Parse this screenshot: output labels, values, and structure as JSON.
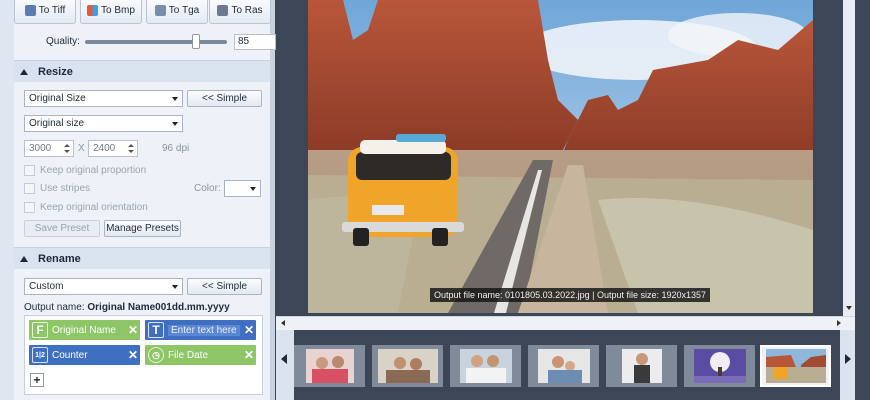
{
  "formats": [
    {
      "label": "To Tiff",
      "icon": "tiff-format-icon",
      "color": "#5b7bb5"
    },
    {
      "label": "To Bmp",
      "icon": "bmp-format-icon",
      "color": "#e6553c"
    },
    {
      "label": "To Tga",
      "icon": "tga-format-icon",
      "color": "#7a8da8"
    },
    {
      "label": "To Ras",
      "icon": "ras-format-icon",
      "color": "#6b7a90"
    }
  ],
  "quality": {
    "label": "Quality:",
    "value": "85",
    "fraction": 0.8
  },
  "resize": {
    "title": "Resize",
    "mode": "Original Size",
    "simple_label": "<< Simple",
    "size_mode": "Original size",
    "width": "3000",
    "height": "2400",
    "separator": "X",
    "dpi": "96 dpi",
    "keep_proportion": "Keep original proportion",
    "use_stripes": "Use stripes",
    "color_label": "Color:",
    "keep_orientation": "Keep original orientation",
    "save_preset": "Save Preset",
    "manage_presets": "Manage Presets"
  },
  "rename": {
    "title": "Rename",
    "mode": "Custom",
    "simple_label": "<< Simple",
    "output_name_label": "Output name:",
    "output_name_value": "Original Name001dd.mm.yyyy",
    "tags": [
      {
        "label": "Original Name",
        "icon": "F",
        "color": "green"
      },
      {
        "label": "Enter text here",
        "icon": "T",
        "color": "blue"
      },
      {
        "label": "Counter",
        "icon": "123",
        "color": "blue"
      },
      {
        "label": "File Date",
        "icon": "clock",
        "color": "green"
      }
    ],
    "add_label": "+"
  },
  "preview": {
    "status_text": "Output file name: 0101805.03.2022.jpg | Output file size: 1920x1357"
  },
  "thumbnails": [
    "family-photo-1",
    "family-photo-2",
    "family-photo-3",
    "family-photo-4",
    "family-photo-5",
    "tree-photo",
    "van-photo"
  ],
  "selected_thumbnail": 6
}
